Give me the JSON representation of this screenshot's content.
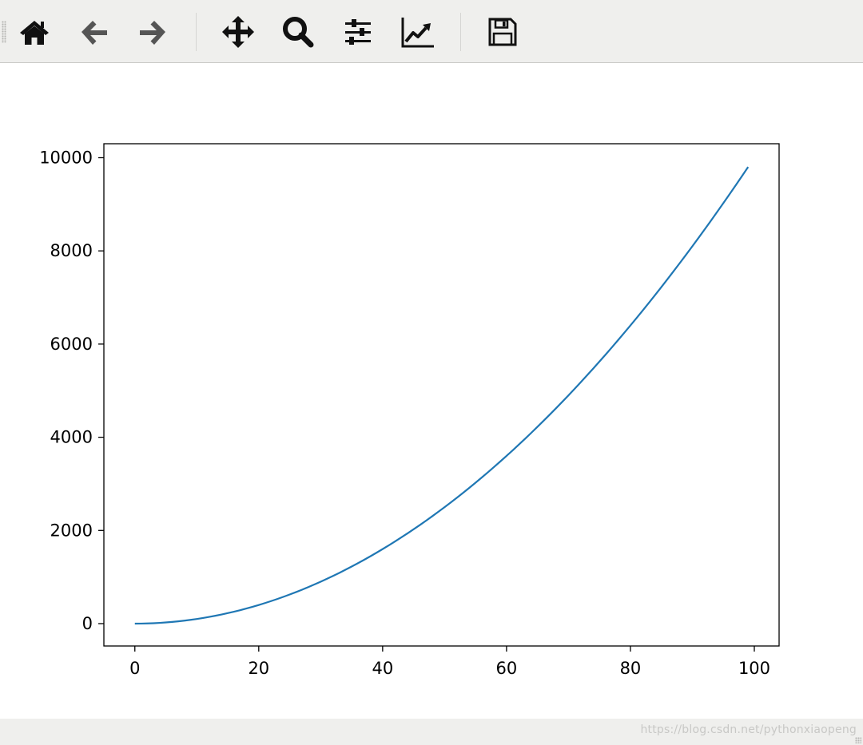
{
  "toolbar": {
    "buttons": [
      {
        "id": "home",
        "icon": "home-icon"
      },
      {
        "id": "back",
        "icon": "arrow-left-icon"
      },
      {
        "id": "forward",
        "icon": "arrow-right-icon"
      },
      {
        "id": "pan",
        "icon": "move-icon"
      },
      {
        "id": "zoom",
        "icon": "magnifier-icon"
      },
      {
        "id": "subplots",
        "icon": "sliders-icon"
      },
      {
        "id": "customize",
        "icon": "line-chart-icon"
      },
      {
        "id": "save",
        "icon": "floppy-disk-icon"
      }
    ]
  },
  "colors": {
    "line": "#1f77b4",
    "toolbar_bg": "#efefed"
  },
  "chart_data": {
    "type": "line",
    "function": "y = x^2",
    "x_start": 0,
    "x_end": 99,
    "x_step": 1,
    "xlim": [
      -5,
      104
    ],
    "ylim": [
      -480,
      10300
    ],
    "xticks": [
      0,
      20,
      40,
      60,
      80,
      100
    ],
    "yticks": [
      0,
      2000,
      4000,
      6000,
      8000,
      10000
    ],
    "xtick_labels": [
      "0",
      "20",
      "40",
      "60",
      "80",
      "100"
    ],
    "ytick_labels": [
      "0",
      "2000",
      "4000",
      "6000",
      "8000",
      "10000"
    ],
    "grid": false,
    "series": [
      {
        "color": "#1f77b4"
      }
    ]
  },
  "watermark": "https://blog.csdn.net/pythonxiaopeng"
}
